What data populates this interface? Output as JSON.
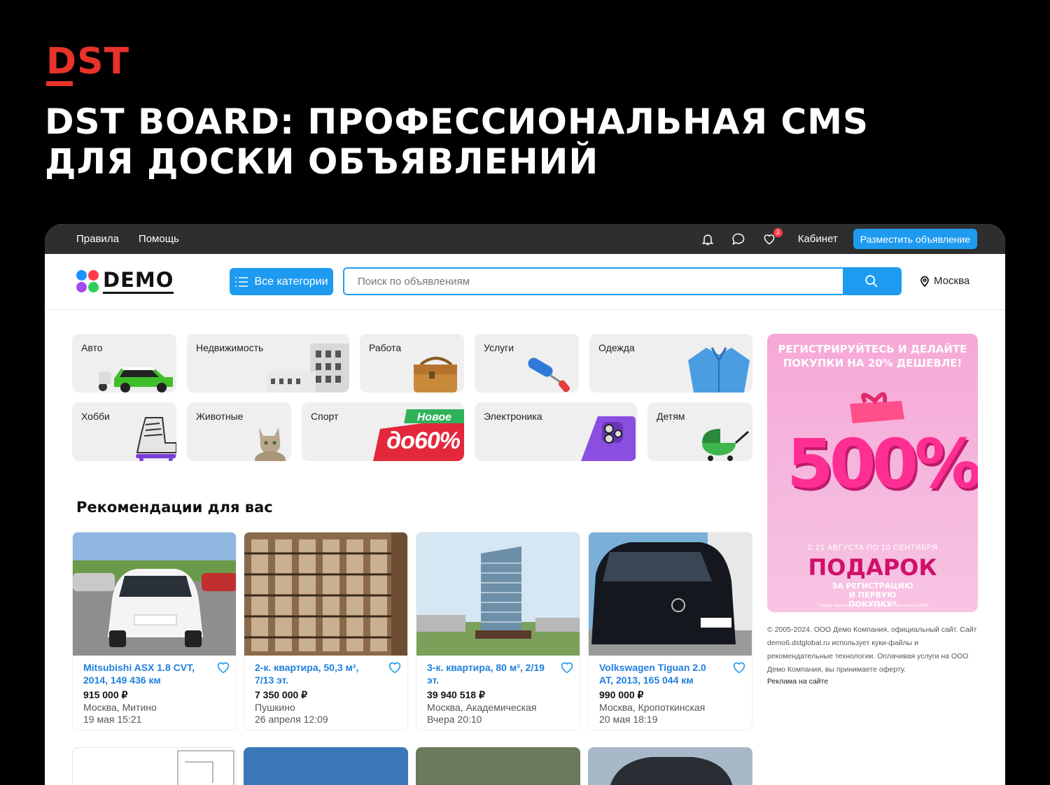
{
  "brand": {
    "logo_text": "DST"
  },
  "headline": {
    "line1": "DST BOARD: ПРОФЕССИОНАЛЬНАЯ CMS",
    "line2": "ДЛЯ ДОСКИ ОБЪЯВЛЕНИЙ"
  },
  "topbar": {
    "links": [
      "Правила",
      "Помощь"
    ],
    "favorites_count": "3",
    "cabinet_label": "Кабинет",
    "post_button": "Разместить объявление"
  },
  "header": {
    "logo_text": "DEMO",
    "categories_button": "Все категории",
    "search_placeholder": "Поиск по объявлениям",
    "city": "Москва"
  },
  "categories": [
    {
      "label": "Авто",
      "icon": "car-icon"
    },
    {
      "label": "Недвижимость",
      "icon": "building-icon"
    },
    {
      "label": "Работа",
      "icon": "bag-icon"
    },
    {
      "label": "Услуги",
      "icon": "roller-icon"
    },
    {
      "label": "Одежда",
      "icon": "shirt-icon"
    },
    {
      "label": "Хобби",
      "icon": "skate-icon"
    },
    {
      "label": "Животные",
      "icon": "cat-icon"
    },
    {
      "label": "Спорт",
      "icon": "sale-icon",
      "promo_badge": "Новое",
      "promo_text": "до60%"
    },
    {
      "label": "Электроника",
      "icon": "phone-icon"
    },
    {
      "label": "Детям",
      "icon": "stroller-icon"
    }
  ],
  "recommendations": {
    "title": "Рекомендации для вас",
    "items": [
      {
        "title": "Mitsubishi ASX 1.8 CVT, 2014, 149 436 км",
        "price": "915 000 ₽",
        "location": "Москва, Митино",
        "date": "19 мая 15:21"
      },
      {
        "title": "2-к. квартира, 50,3 м², 7/13 эт.",
        "price": "7 350 000 ₽",
        "location": "Пушкино",
        "date": "26 апреля 12:09"
      },
      {
        "title": "3-к. квартира, 80 м², 2/19 эт.",
        "price": "39 940 518 ₽",
        "location": "Москва, Академическая",
        "date": "Вчера 20:10"
      },
      {
        "title": "Volkswagen Tiguan 2.0 AT, 2013, 165 044 км",
        "price": "990 000 ₽",
        "location": "Москва, Кропоткинская",
        "date": "20 мая 18:19"
      }
    ]
  },
  "ad": {
    "headline": "РЕГИСТРИРУЙТЕСЬ И ДЕЛАЙТЕ ПОКУПКИ НА 20% ДЕШЕВЛЕ!",
    "amount": "500%",
    "date_range": "С 21 АВГУСТА ПО 10 СЕНТЯБРЯ",
    "gift": "ПОДАРОК",
    "subtitle": "ЗА РЕГИСТРАЦИЮ И ПЕРВУЮ ПОКУПКУ*",
    "fine_print": "* Подарок будет доступен с 10 сентября для оплаты заказа от 1500₽"
  },
  "footer": {
    "copyright": "© 2005-2024. ООО Демо Компания, официальный сайт. Сайт demo6.dstglobal.ru использует куки-файлы и рекомендательные технологии. Оплачивая услуги на ООО Демо Компания, вы принимаете оферту.",
    "ads_link": "Реклама на сайте"
  },
  "colors": {
    "accent": "#1e9bf0",
    "brand_red": "#e8322a",
    "link": "#1e7fdf"
  }
}
